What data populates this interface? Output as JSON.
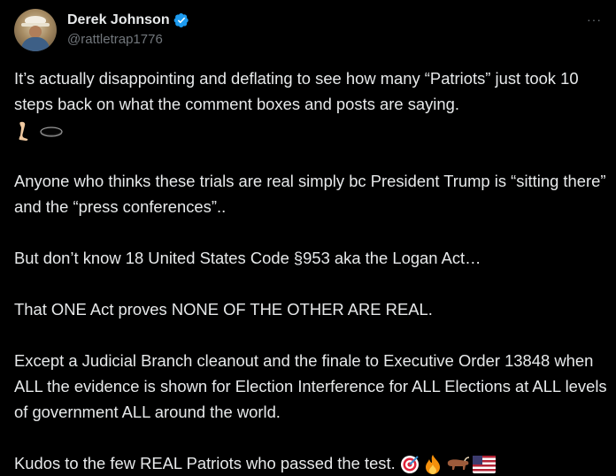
{
  "author": {
    "display_name": "Derek Johnson",
    "handle": "@rattletrap1776",
    "verified_color": "#1d9bf0"
  },
  "menu": {
    "more_label": "···"
  },
  "tweet": {
    "p1": "It’s actually disappointing and deflating to see how many “Patriots” just took 10 steps back on what the comment boxes and posts are saying.",
    "p1_emojis": [
      "leg-icon",
      "hole-icon"
    ],
    "p2": "Anyone who thinks these trials are real simply bc President Trump is “sitting there” and the “press conferences”..",
    "p3": "But don’t know 18 United States Code §953 aka the Logan Act…",
    "p4": "That ONE Act proves NONE OF THE OTHER ARE REAL.",
    "p5": "Except a Judicial Branch cleanout and the finale to Executive Order 13848 when ALL the evidence is shown for Election Interference for ALL Elections at ALL levels of government ALL around the world.",
    "p6": "Kudos to the few REAL Patriots who passed the test.",
    "p6_emojis": [
      "target-icon",
      "fire-icon",
      "ox-icon",
      "us-flag-icon"
    ]
  },
  "colors": {
    "background": "#000000",
    "text": "#e7e9ea",
    "secondary": "#71767b"
  }
}
